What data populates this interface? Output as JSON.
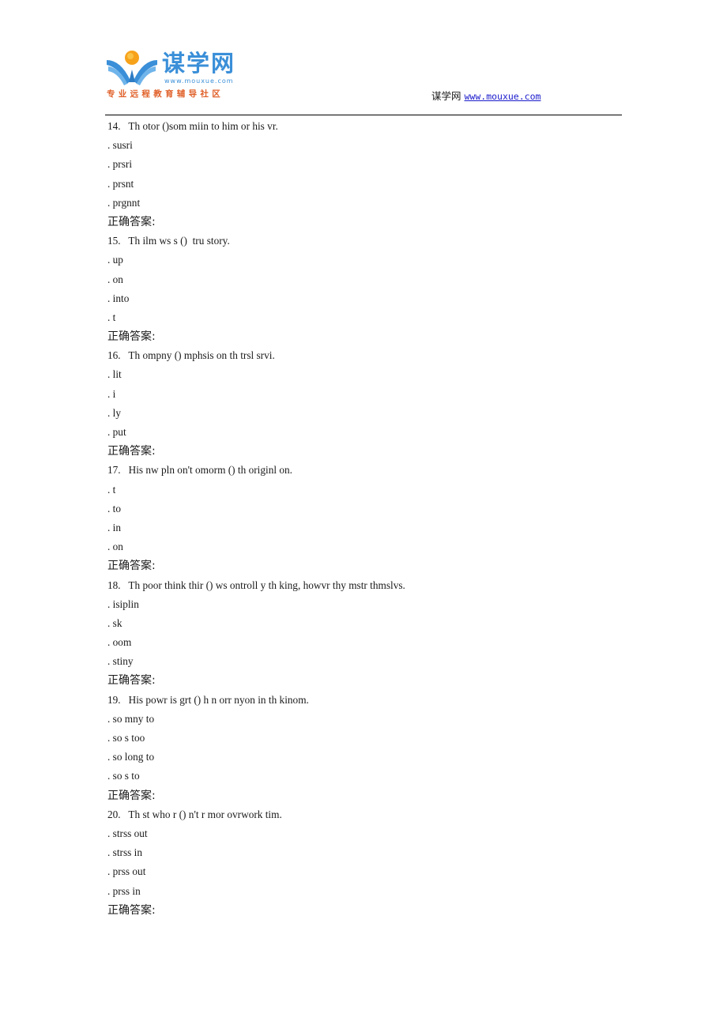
{
  "header": {
    "logo": {
      "title": "谋学网",
      "url_text": "www.mouxue.com",
      "slogan": "专业远程教育辅导社区",
      "colors": {
        "blue": "#3a8fd8",
        "orange": "#e0612a",
        "sun": "#f7a21b"
      }
    },
    "site_name": "谋学网",
    "site_link": "www.mouxue.com"
  },
  "questions": [
    {
      "number": "14.",
      "text": "Th otor ()som miin to him or his vr.",
      "options": [
        "susri",
        "prsri",
        "prsnt",
        "prgnnt"
      ],
      "answer_label": "正确答案:"
    },
    {
      "number": "15.",
      "text": "Th ilm ws s ()  tru story.",
      "options": [
        "up",
        "on",
        "into",
        "t"
      ],
      "answer_label": "正确答案:"
    },
    {
      "number": "16.",
      "text": "Th ompny () mphsis on th trsl srvi.",
      "options": [
        "lit",
        "i",
        "ly",
        "put"
      ],
      "answer_label": "正确答案:"
    },
    {
      "number": "17.",
      "text": "His nw pln on't omorm () th originl on.",
      "options": [
        "t",
        "to",
        "in",
        "on"
      ],
      "answer_label": "正确答案:"
    },
    {
      "number": "18.",
      "text": "Th poor think thir () ws ontroll y th king, howvr thy mstr thmslvs.",
      "options": [
        "isiplin",
        "sk",
        "oom",
        "stiny"
      ],
      "answer_label": "正确答案:"
    },
    {
      "number": "19.",
      "text": "His powr is grt () h n orr nyon in th kinom.",
      "options": [
        "so mny to",
        "so s too",
        "so long to",
        "so s to"
      ],
      "answer_label": "正确答案:"
    },
    {
      "number": "20.",
      "text": "Th st who r () n't r mor ovrwork tim.",
      "options": [
        "strss out",
        "strss in",
        "prss out",
        "prss in"
      ],
      "answer_label": "正确答案:"
    }
  ],
  "option_prefix": ". "
}
